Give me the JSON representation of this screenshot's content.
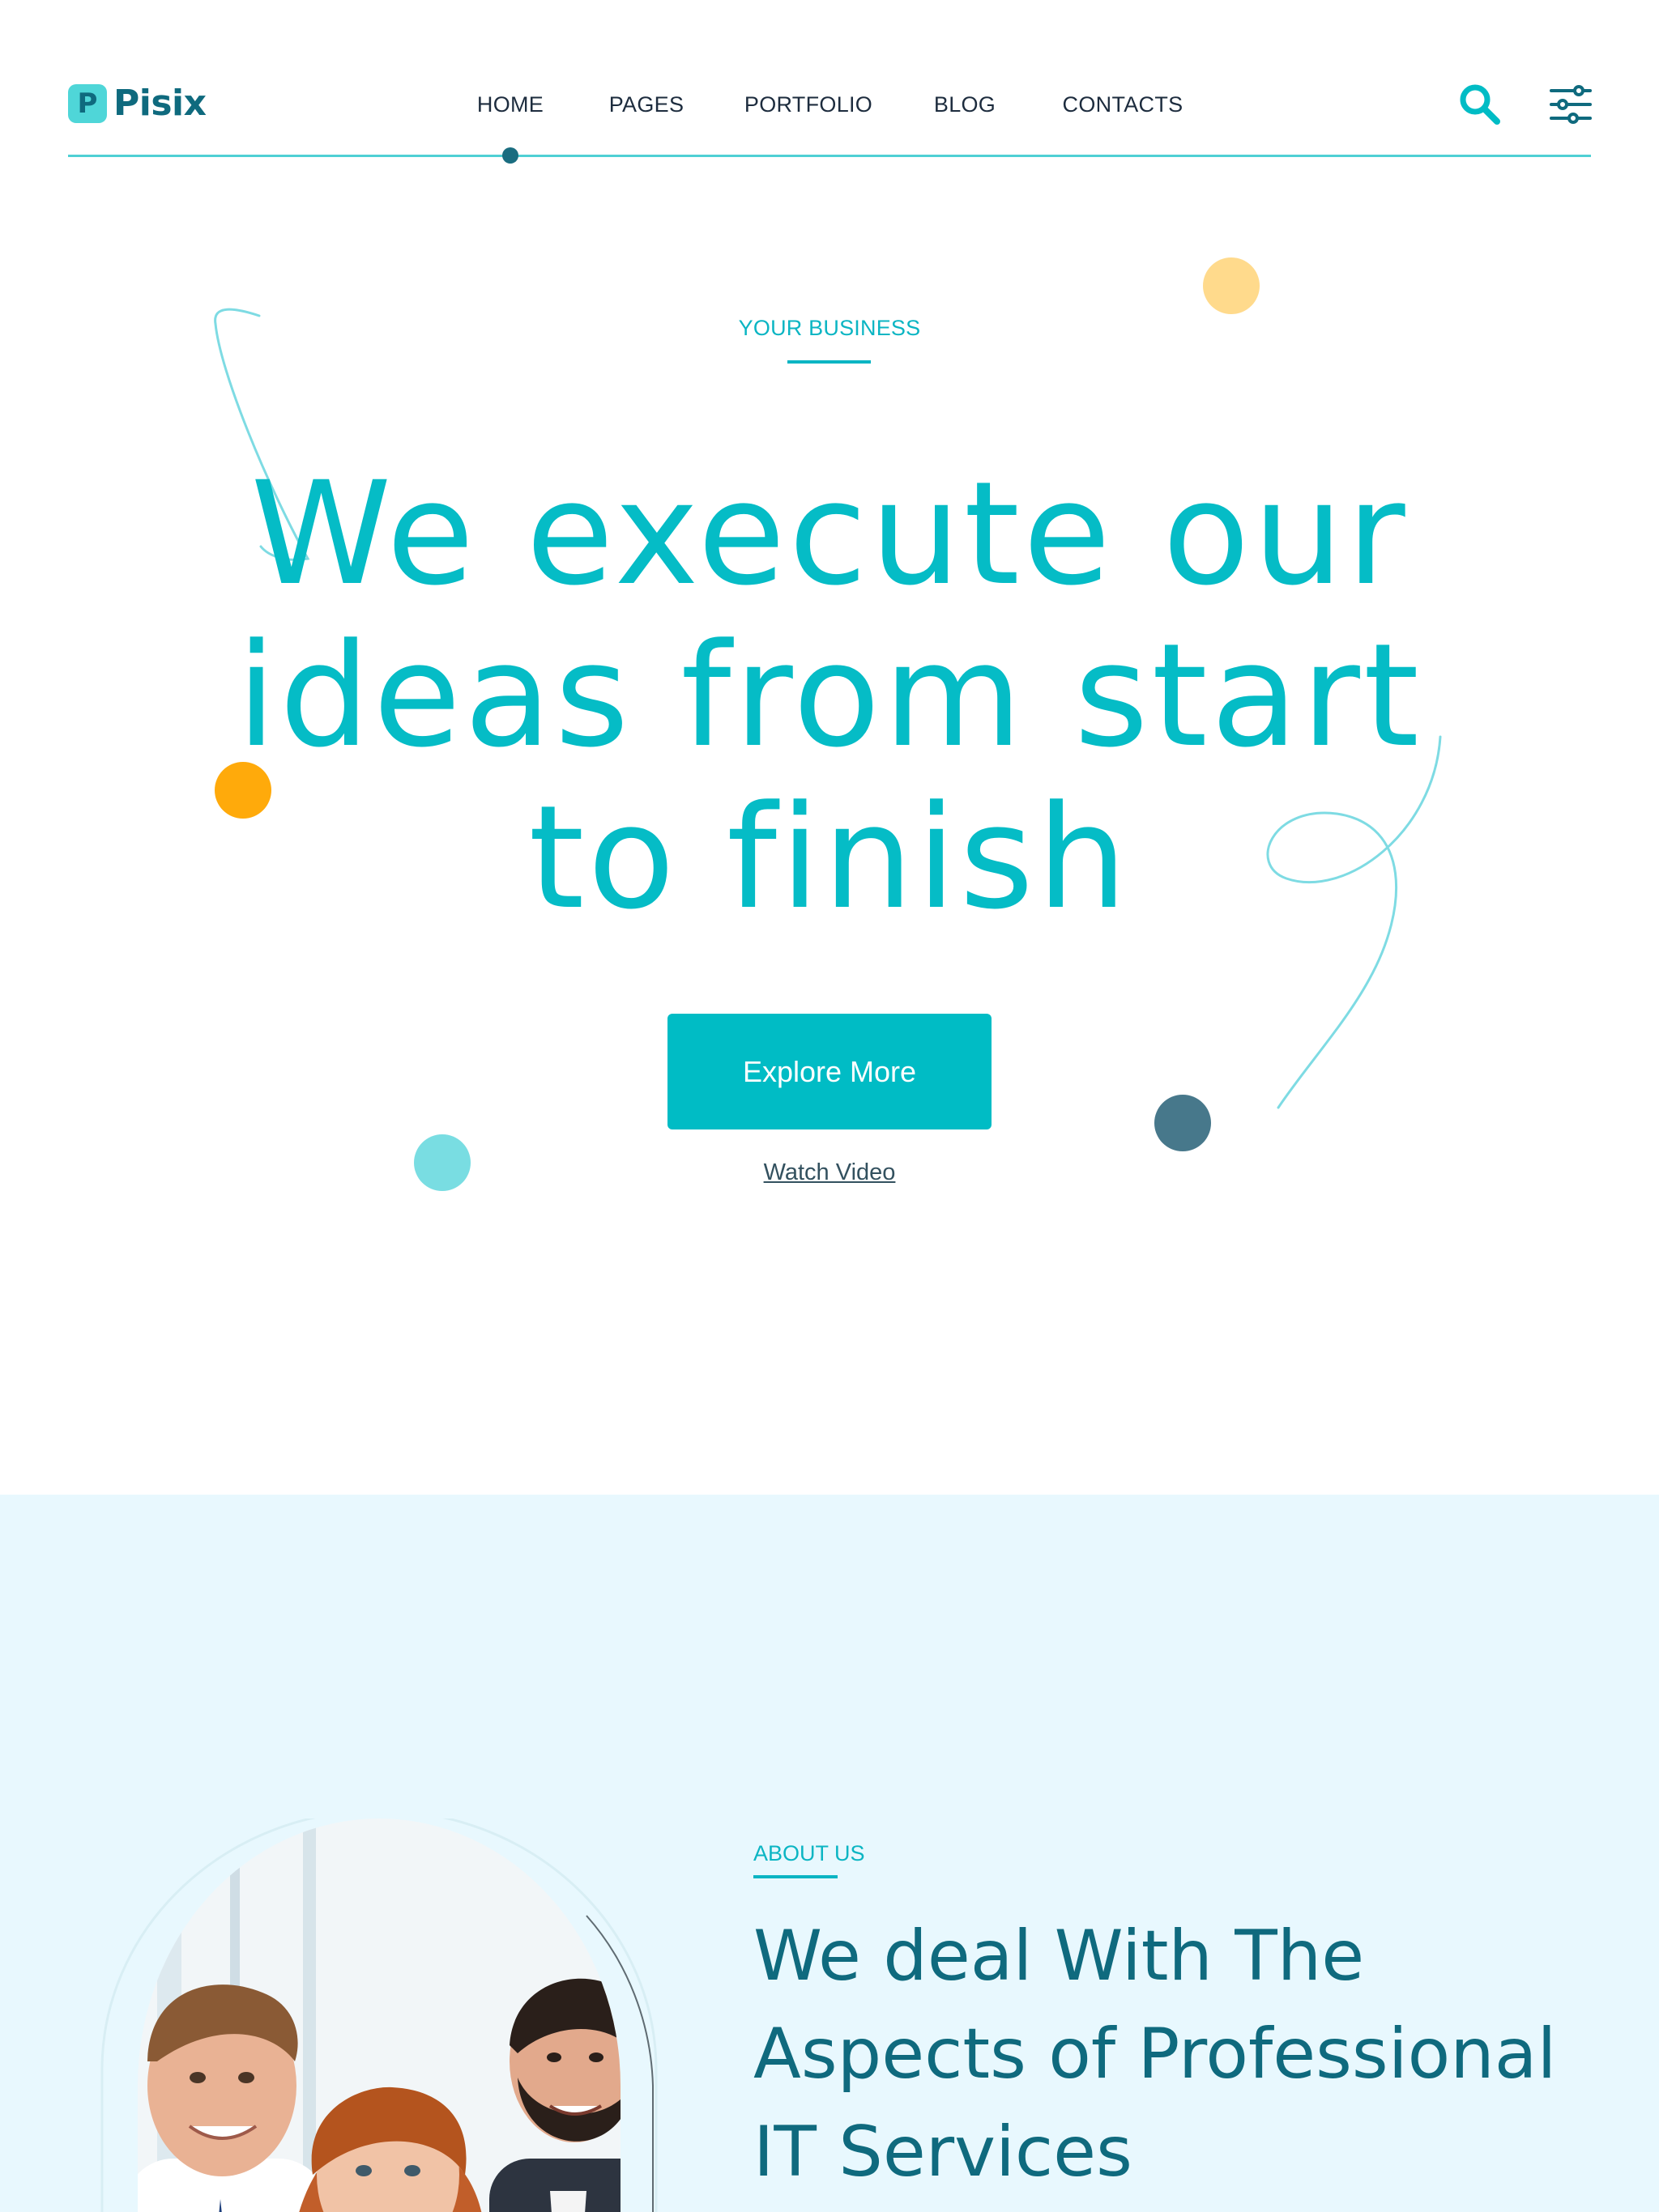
{
  "brand": {
    "logo_letter": "P",
    "name": "Pisix"
  },
  "nav": {
    "items": [
      {
        "label": "HOME"
      },
      {
        "label": "PAGES"
      },
      {
        "label": "PORTFOLIO"
      },
      {
        "label": "BLOG"
      },
      {
        "label": "CONTACTS"
      }
    ],
    "active_index": 0
  },
  "header_icons": {
    "search": "search-icon",
    "menu": "sliders-menu-icon"
  },
  "hero": {
    "eyebrow": "YOUR BUSINESS",
    "title_lines": [
      "We execute our",
      "ideas from start",
      "to finish"
    ],
    "cta_label": "Explore More",
    "secondary_link": "Watch Video"
  },
  "about": {
    "eyebrow": "ABOUT US",
    "title_lines": [
      "We deal With The",
      "Aspects of Professional",
      "IT Services"
    ],
    "image": "team-photo"
  },
  "colors": {
    "accent": "#00bcc5",
    "dark_teal": "#0f6a7e",
    "nav_text": "#1d2c3e",
    "about_bg": "#e8f8fe",
    "dot_yellow_light": "#ffda8c",
    "dot_orange": "#ffaa0b",
    "dot_cyan": "#79dde2",
    "dot_slate": "#47788b"
  }
}
